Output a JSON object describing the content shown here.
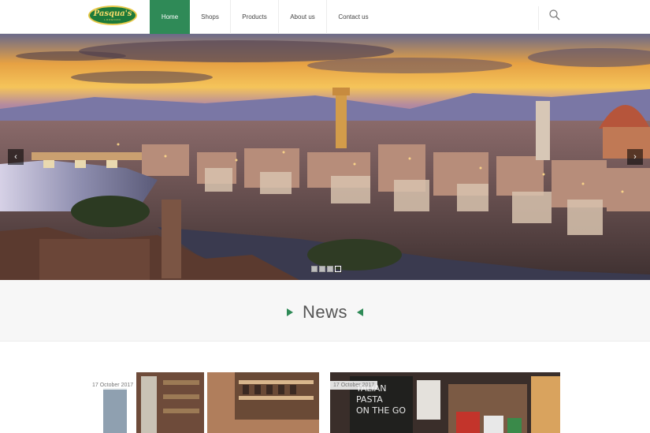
{
  "brand": {
    "logo_text": "Pasqua's",
    "logo_sub": "LORENZO"
  },
  "nav": {
    "items": [
      {
        "label": "Home"
      },
      {
        "label": "Shops"
      },
      {
        "label": "Products"
      },
      {
        "label": "About us"
      },
      {
        "label": "Contact us"
      }
    ],
    "active": "Home"
  },
  "search": {
    "icon": "search-icon"
  },
  "hero": {
    "prev_icon": "‹",
    "next_icon": "›",
    "slide_count": 4,
    "active_slide": 4
  },
  "news": {
    "title": "News",
    "cards": [
      {
        "date": "17 October 2017"
      },
      {
        "date": "17 October 2017"
      }
    ]
  },
  "colors": {
    "accent": "#2f8a57",
    "header_bg": "#ffffff",
    "page_bg": "#f7f7f7"
  }
}
